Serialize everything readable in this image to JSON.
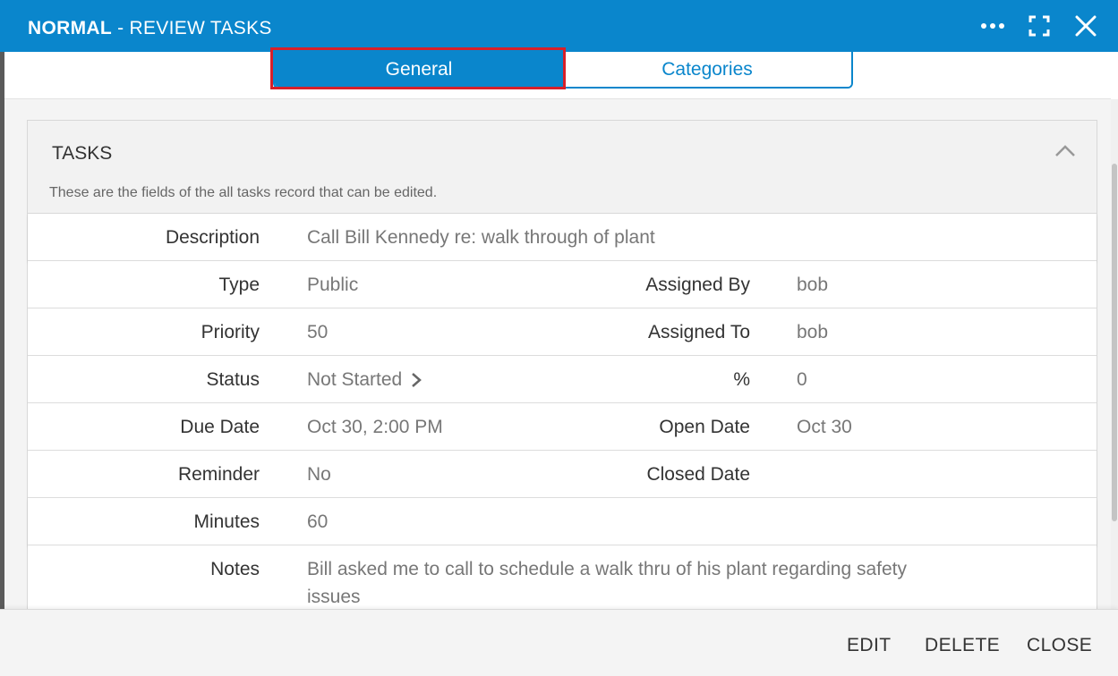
{
  "titlebar": {
    "mode": "NORMAL",
    "separator": " - ",
    "title": "REVIEW TASKS"
  },
  "tabs": [
    {
      "label": "General",
      "active": true
    },
    {
      "label": "Categories",
      "active": false
    }
  ],
  "panel": {
    "title": "TASKS",
    "subtitle": "These are the fields of the all tasks record that can be edited."
  },
  "fields": {
    "description": {
      "label": "Description",
      "value": "Call Bill Kennedy re: walk through of plant"
    },
    "type": {
      "label": "Type",
      "value": "Public"
    },
    "assigned_by": {
      "label": "Assigned By",
      "value": "bob"
    },
    "priority": {
      "label": "Priority",
      "value": "50"
    },
    "assigned_to": {
      "label": "Assigned To",
      "value": "bob"
    },
    "status": {
      "label": "Status",
      "value": "Not Started"
    },
    "percent": {
      "label": "%",
      "value": "0"
    },
    "due_date": {
      "label": "Due Date",
      "value": "Oct 30, 2:00 PM"
    },
    "open_date": {
      "label": "Open Date",
      "value": "Oct 30"
    },
    "reminder": {
      "label": "Reminder",
      "value": "No"
    },
    "closed_date": {
      "label": "Closed Date",
      "value": ""
    },
    "minutes": {
      "label": "Minutes",
      "value": "60"
    },
    "notes": {
      "label": "Notes",
      "value": "Bill asked me to call to schedule a walk thru of his plant regarding safety issues"
    }
  },
  "footer": {
    "edit": "EDIT",
    "delete": "DELETE",
    "close": "CLOSE"
  },
  "colors": {
    "accent": "#0a86cc",
    "highlight": "#d7202a"
  },
  "icons": [
    "more-icon",
    "fullscreen-icon",
    "close-icon",
    "chevron-up-icon",
    "chevron-right-icon"
  ]
}
